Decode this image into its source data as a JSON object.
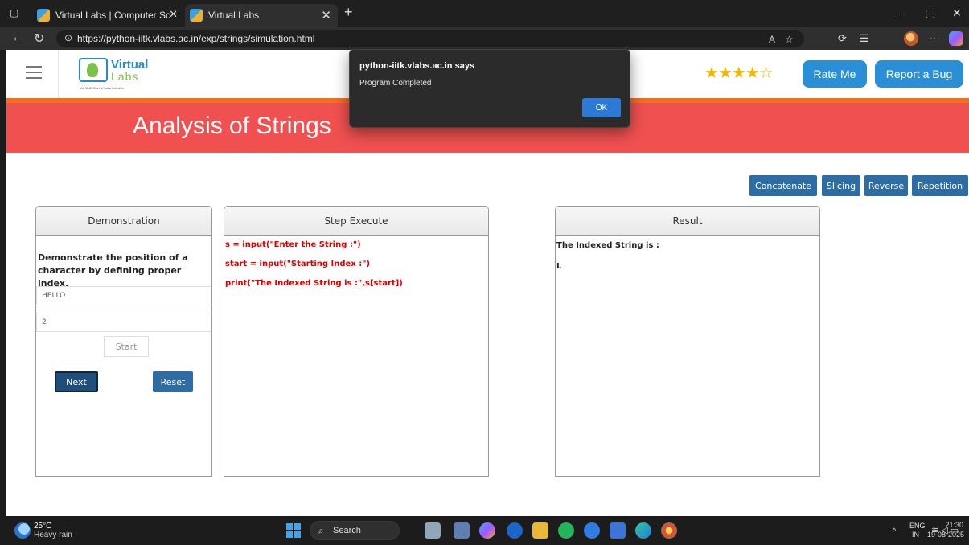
{
  "browser": {
    "tabs": [
      {
        "title": "Virtual Labs | Computer Science &",
        "active": false
      },
      {
        "title": "Virtual Labs",
        "active": true
      }
    ],
    "url": "https://python-iitk.vlabs.ac.in/exp/strings/simulation.html",
    "icons": [
      "sidebar-icon",
      "back-icon",
      "reload-icon",
      "lock-icon",
      "read-aloud-icon",
      "favorite-icon",
      "extensions-icon",
      "favorites-list-icon",
      "profile-avatar",
      "more-icon",
      "copilot-icon"
    ]
  },
  "header": {
    "logo_virtual": "Virtual",
    "logo_labs": "Labs",
    "logo_tagline": "An MoE Govt of India Initiative",
    "rating_filled": 4,
    "rating_total": 5,
    "rate_me_label": "Rate Me",
    "report_bug_label": "Report a Bug"
  },
  "banner": {
    "title": "Analysis of Strings"
  },
  "operations": [
    "Concatenate",
    "Slicing",
    "Reverse",
    "Repetition"
  ],
  "demonstration": {
    "title": "Demonstration",
    "description": "Demonstrate the position of a character by defining proper index.",
    "string_value": "HELLO",
    "index_value": "2",
    "start_label": "Start",
    "next_label": "Next",
    "reset_label": "Reset"
  },
  "step_execute": {
    "title": "Step Execute",
    "lines": [
      "s = input(\"Enter the String :\")",
      "start = input(\"Starting Index :\")",
      "print(\"The Indexed String is :\",s[start])"
    ]
  },
  "result": {
    "title": "Result",
    "label": "The Indexed String is :",
    "value": "L"
  },
  "alert": {
    "title": "python-iitk.vlabs.ac.in says",
    "message": "Program Completed",
    "ok_label": "OK"
  },
  "taskbar": {
    "weather_temp": "25°C",
    "weather_desc": "Heavy rain",
    "search_label": "Search",
    "lang_top": "ENG",
    "lang_bottom": "IN",
    "time": "21:30",
    "date": "19-08-2025"
  }
}
